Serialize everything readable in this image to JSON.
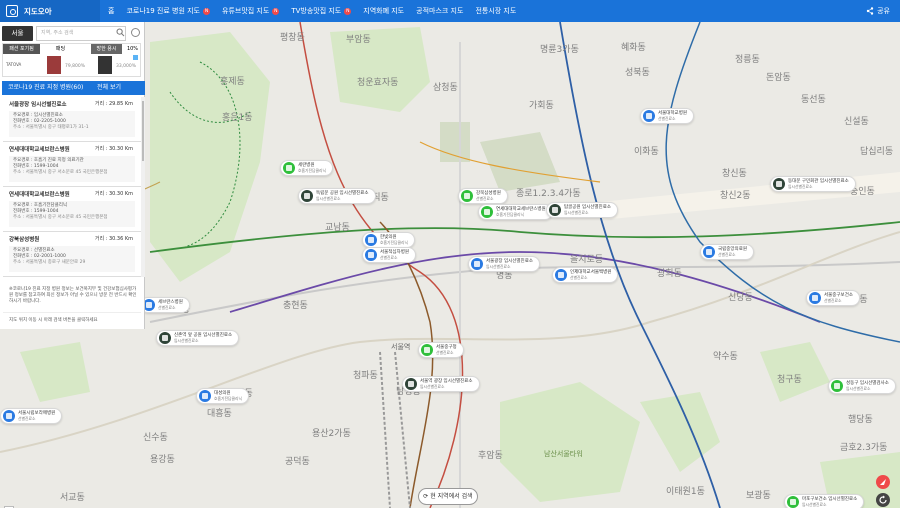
{
  "topbar": {
    "logo": "지도오아",
    "nav": [
      {
        "label": "홈",
        "badge": ""
      },
      {
        "label": "코로나19 진료 병원 지도",
        "badge": "N"
      },
      {
        "label": "유튜브맛집 지도",
        "badge": "N"
      },
      {
        "label": "TV방송맛집 지도",
        "badge": "N"
      },
      {
        "label": "지역화폐 지도",
        "badge": ""
      },
      {
        "label": "공적마스크 지도",
        "badge": ""
      },
      {
        "label": "전통시장 지도",
        "badge": ""
      }
    ],
    "share": "공유"
  },
  "panel": {
    "region_tab": "서울",
    "search_placeholder": "지역, 주소 검색",
    "ad": {
      "tabs": [
        "패션 포기됨",
        "패딩",
        "방한 용시",
        "10%"
      ],
      "brand": "TATOVA",
      "prices": [
        "79,800%",
        "33,000%"
      ]
    },
    "list_header": "코로나19 진료 지정 병원(60)",
    "list_all": "전체 보기",
    "cards": [
      {
        "name": "서울광장 임시선별진료소",
        "dist": "거리 : 29.85 Km",
        "line1": "주요경로 : 임시선별진료소",
        "line2": "전화번호 : 02-2205-1000",
        "line3": "주소 : 서울특별시 중구 태평로1가 31-1"
      },
      {
        "name": "연세대대학교세브란스병원",
        "dist": "거리 : 30.30 Km",
        "line1": "주요경로 : 호흡기 진료 지정 의료기관",
        "line2": "전화번호 : 1599-1004",
        "line3": "주소 : 서울특별시 중구 서소문로 45 국민은행본점"
      },
      {
        "name": "연세대대학교세브란스병원",
        "dist": "거리 : 30.30 Km",
        "line1": "주요경로 : 호흡기전담클리닉",
        "line2": "전화번호 : 1599-1004",
        "line3": "주소 : 서울특별시 중구 서소문로 45 국민은행본점"
      },
      {
        "name": "강북삼성병원",
        "dist": "거리 : 30.36 Km",
        "line1": "주요경로 : 선별진료소",
        "line2": "전화번호 : 02-2001-1000",
        "line3": "주소 : 서울특별시 종로구 새문안로 29"
      }
    ],
    "notice": "※코로나19 진료 지정 병원 정보는 보건복지부 및 건강보험심사평가원 정보를 참고하여 최신 정보가 아닐 수 있으니 방문 전 반드시 확인하시기 바랍니다.",
    "notice2": "지도 위치 이동 시 아래 검색 버튼을 클릭하세요"
  },
  "map": {
    "search_here": "현 지역에서 검색",
    "markers": [
      {
        "title": "세란병원",
        "sub": "호흡기전담클리닉",
        "color": "green"
      },
      {
        "title": "독립문 공원 임시선별진료소",
        "sub": "임시선별진료소",
        "color": "dark"
      },
      {
        "title": "한빛의원",
        "sub": "호흡기전담클리닉",
        "color": "blue"
      },
      {
        "title": "서울적십자병원",
        "sub": "선별진료소",
        "color": "blue"
      },
      {
        "title": "강북삼성병원",
        "sub": "선별진료소",
        "color": "green"
      },
      {
        "title": "연세대대학교세브란스병원",
        "sub": "호흡기전담클리닉",
        "color": "green"
      },
      {
        "title": "탑골공원 임시선별진료소",
        "sub": "임시선별진료소",
        "color": "dark"
      },
      {
        "title": "서울광장 임시선별진료소",
        "sub": "임시선별진료소",
        "color": "blue"
      },
      {
        "title": "서울대학교병원",
        "sub": "선별진료소",
        "color": "blue"
      },
      {
        "title": "국립중앙의료원",
        "sub": "선별진료소",
        "color": "blue"
      },
      {
        "title": "인제대학교서울백병원",
        "sub": "선별진료소",
        "color": "blue"
      },
      {
        "title": "신촌역 앞 공원 임시선별진료소",
        "sub": "임시선별진료소",
        "color": "dark"
      },
      {
        "title": "세브란스병원",
        "sub": "선별진료소",
        "color": "blue"
      },
      {
        "title": "서울역 광장 임시선별진료소",
        "sub": "임시선별진료소",
        "color": "dark"
      },
      {
        "title": "서울중구청",
        "sub": "선별진료소",
        "color": "green"
      },
      {
        "title": "동대문 구민회관 임시선별진료소",
        "sub": "임시선별진료소",
        "color": "dark"
      },
      {
        "title": "서울중구보건소",
        "sub": "선별진료소",
        "color": "blue"
      },
      {
        "title": "대성의원",
        "sub": "호흡기전담클리닉",
        "color": "blue"
      },
      {
        "title": "서울시립보라매병원",
        "sub": "선별진료소",
        "color": "blue"
      },
      {
        "title": "성동구 임시선별검사소",
        "sub": "임시선별진료소",
        "color": "dark"
      },
      {
        "title": "마포구보건소 임시선별진료소",
        "sub": "임시선별진료소",
        "color": "dark"
      }
    ],
    "labels": [
      "홍제동",
      "청운효자동",
      "삼청동",
      "가회동",
      "혜화동",
      "평창동",
      "부암동",
      "이화동",
      "창신동",
      "종로1.2.3.4가동",
      "사직동",
      "교남동",
      "명동",
      "을지로동",
      "광희동",
      "신당동",
      "충현동",
      "남영동",
      "후암동",
      "청파동",
      "공덕동",
      "용산2가동",
      "이태원1동",
      "약수동",
      "청구동",
      "금호2.3가동",
      "왕십리도선동",
      "행당동",
      "보광동",
      "남산서울타워",
      "서울역",
      "대흥동",
      "신수동",
      "용강동",
      "아현동",
      "서교동",
      "연희동",
      "홍은1동",
      "창신2동",
      "숭인동",
      "신설동",
      "답십리동",
      "정릉동",
      "돈암동",
      "동선동",
      "성북동",
      "명륜3가동"
    ]
  }
}
